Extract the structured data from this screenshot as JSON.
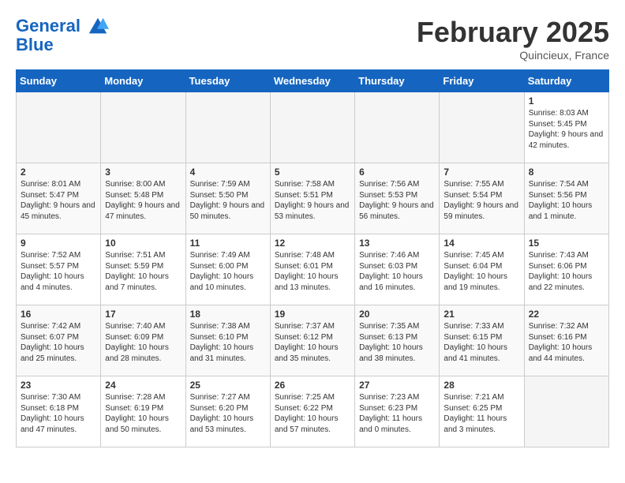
{
  "header": {
    "logo_line1": "General",
    "logo_line2": "Blue",
    "month_year": "February 2025",
    "location": "Quincieux, France"
  },
  "weekdays": [
    "Sunday",
    "Monday",
    "Tuesday",
    "Wednesday",
    "Thursday",
    "Friday",
    "Saturday"
  ],
  "weeks": [
    [
      {
        "day": "",
        "info": ""
      },
      {
        "day": "",
        "info": ""
      },
      {
        "day": "",
        "info": ""
      },
      {
        "day": "",
        "info": ""
      },
      {
        "day": "",
        "info": ""
      },
      {
        "day": "",
        "info": ""
      },
      {
        "day": "1",
        "info": "Sunrise: 8:03 AM\nSunset: 5:45 PM\nDaylight: 9 hours and 42 minutes."
      }
    ],
    [
      {
        "day": "2",
        "info": "Sunrise: 8:01 AM\nSunset: 5:47 PM\nDaylight: 9 hours and 45 minutes."
      },
      {
        "day": "3",
        "info": "Sunrise: 8:00 AM\nSunset: 5:48 PM\nDaylight: 9 hours and 47 minutes."
      },
      {
        "day": "4",
        "info": "Sunrise: 7:59 AM\nSunset: 5:50 PM\nDaylight: 9 hours and 50 minutes."
      },
      {
        "day": "5",
        "info": "Sunrise: 7:58 AM\nSunset: 5:51 PM\nDaylight: 9 hours and 53 minutes."
      },
      {
        "day": "6",
        "info": "Sunrise: 7:56 AM\nSunset: 5:53 PM\nDaylight: 9 hours and 56 minutes."
      },
      {
        "day": "7",
        "info": "Sunrise: 7:55 AM\nSunset: 5:54 PM\nDaylight: 9 hours and 59 minutes."
      },
      {
        "day": "8",
        "info": "Sunrise: 7:54 AM\nSunset: 5:56 PM\nDaylight: 10 hours and 1 minute."
      }
    ],
    [
      {
        "day": "9",
        "info": "Sunrise: 7:52 AM\nSunset: 5:57 PM\nDaylight: 10 hours and 4 minutes."
      },
      {
        "day": "10",
        "info": "Sunrise: 7:51 AM\nSunset: 5:59 PM\nDaylight: 10 hours and 7 minutes."
      },
      {
        "day": "11",
        "info": "Sunrise: 7:49 AM\nSunset: 6:00 PM\nDaylight: 10 hours and 10 minutes."
      },
      {
        "day": "12",
        "info": "Sunrise: 7:48 AM\nSunset: 6:01 PM\nDaylight: 10 hours and 13 minutes."
      },
      {
        "day": "13",
        "info": "Sunrise: 7:46 AM\nSunset: 6:03 PM\nDaylight: 10 hours and 16 minutes."
      },
      {
        "day": "14",
        "info": "Sunrise: 7:45 AM\nSunset: 6:04 PM\nDaylight: 10 hours and 19 minutes."
      },
      {
        "day": "15",
        "info": "Sunrise: 7:43 AM\nSunset: 6:06 PM\nDaylight: 10 hours and 22 minutes."
      }
    ],
    [
      {
        "day": "16",
        "info": "Sunrise: 7:42 AM\nSunset: 6:07 PM\nDaylight: 10 hours and 25 minutes."
      },
      {
        "day": "17",
        "info": "Sunrise: 7:40 AM\nSunset: 6:09 PM\nDaylight: 10 hours and 28 minutes."
      },
      {
        "day": "18",
        "info": "Sunrise: 7:38 AM\nSunset: 6:10 PM\nDaylight: 10 hours and 31 minutes."
      },
      {
        "day": "19",
        "info": "Sunrise: 7:37 AM\nSunset: 6:12 PM\nDaylight: 10 hours and 35 minutes."
      },
      {
        "day": "20",
        "info": "Sunrise: 7:35 AM\nSunset: 6:13 PM\nDaylight: 10 hours and 38 minutes."
      },
      {
        "day": "21",
        "info": "Sunrise: 7:33 AM\nSunset: 6:15 PM\nDaylight: 10 hours and 41 minutes."
      },
      {
        "day": "22",
        "info": "Sunrise: 7:32 AM\nSunset: 6:16 PM\nDaylight: 10 hours and 44 minutes."
      }
    ],
    [
      {
        "day": "23",
        "info": "Sunrise: 7:30 AM\nSunset: 6:18 PM\nDaylight: 10 hours and 47 minutes."
      },
      {
        "day": "24",
        "info": "Sunrise: 7:28 AM\nSunset: 6:19 PM\nDaylight: 10 hours and 50 minutes."
      },
      {
        "day": "25",
        "info": "Sunrise: 7:27 AM\nSunset: 6:20 PM\nDaylight: 10 hours and 53 minutes."
      },
      {
        "day": "26",
        "info": "Sunrise: 7:25 AM\nSunset: 6:22 PM\nDaylight: 10 hours and 57 minutes."
      },
      {
        "day": "27",
        "info": "Sunrise: 7:23 AM\nSunset: 6:23 PM\nDaylight: 11 hours and 0 minutes."
      },
      {
        "day": "28",
        "info": "Sunrise: 7:21 AM\nSunset: 6:25 PM\nDaylight: 11 hours and 3 minutes."
      },
      {
        "day": "",
        "info": ""
      }
    ]
  ]
}
